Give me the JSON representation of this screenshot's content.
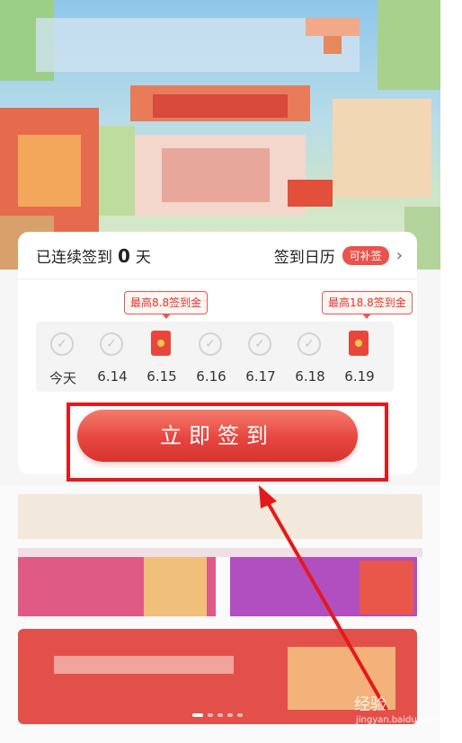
{
  "checkin": {
    "streak_prefix": "已连续签到",
    "streak_count": "0",
    "streak_suffix": "天",
    "calendar_label": "签到日历",
    "makeup_badge": "可补签",
    "tooltips": [
      "最高8.8签到金",
      "最高18.8签到金"
    ],
    "days": [
      {
        "label": "今天",
        "icon": "check-icon"
      },
      {
        "label": "6.14",
        "icon": "check-icon"
      },
      {
        "label": "6.15",
        "icon": "red-envelope-icon"
      },
      {
        "label": "6.16",
        "icon": "check-icon"
      },
      {
        "label": "6.17",
        "icon": "check-icon"
      },
      {
        "label": "6.18",
        "icon": "check-icon"
      },
      {
        "label": "6.19",
        "icon": "red-envelope-icon"
      }
    ],
    "sign_button": "立即签到"
  },
  "watermark": {
    "text": "经验",
    "sub": "jingyan.baidu.com"
  },
  "colors": {
    "accent": "#e6463f",
    "annotation": "#e5191b",
    "tooltip_border": "#e35a4f"
  }
}
